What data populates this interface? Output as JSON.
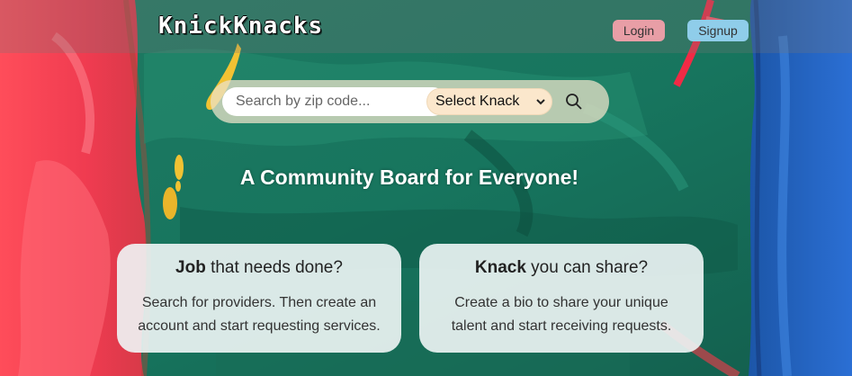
{
  "header": {
    "logo": "KnickKnacks",
    "login_label": "Login",
    "signup_label": "Signup"
  },
  "search": {
    "placeholder": "Search by zip code...",
    "select_value": "Select Knack",
    "search_icon": "search-icon"
  },
  "hero": {
    "headline": "A Community Board for Everyone!"
  },
  "cards": [
    {
      "title_bold": "Job",
      "title_rest": " that needs done?",
      "line1": "Search for providers. Then create an",
      "line2": "account and start requesting services."
    },
    {
      "title_bold": "Knack",
      "title_rest": " you can share?",
      "line1": "Create a bio to share your unique",
      "line2": "talent and start receiving requests."
    }
  ],
  "colors": {
    "login_button": "#e89ea6",
    "signup_button": "#8fcdea",
    "select_background": "#fbe7cc",
    "searchbar_background": "#ebe1c8"
  }
}
